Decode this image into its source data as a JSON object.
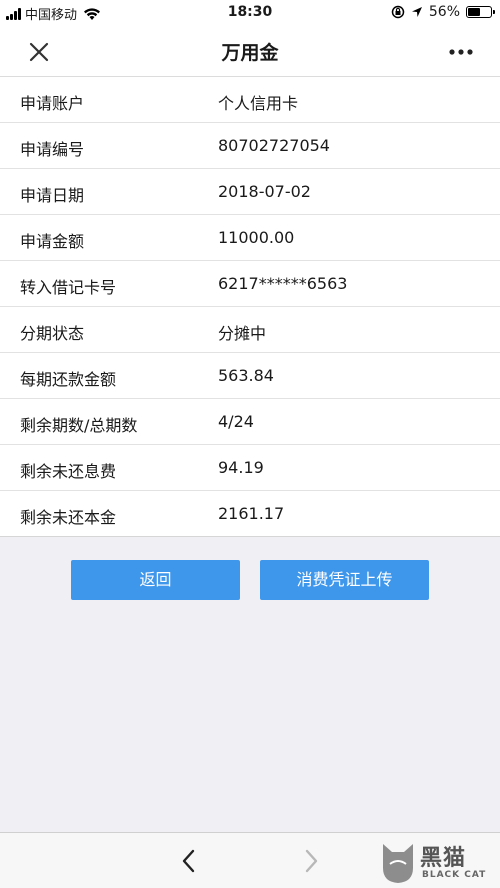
{
  "status_bar": {
    "carrier": "中国移动",
    "time": "18:30",
    "battery": "56%",
    "battery_level": 0.56
  },
  "nav": {
    "title": "万用金",
    "close_icon": "close-icon",
    "more_icon": "more-icon"
  },
  "details": [
    {
      "label": "申请账户",
      "value": "个人信用卡"
    },
    {
      "label": "申请编号",
      "value": "80702727054"
    },
    {
      "label": "申请日期",
      "value": "2018-07-02"
    },
    {
      "label": "申请金额",
      "value": "11000.00"
    },
    {
      "label": "转入借记卡号",
      "value": "6217******6563"
    },
    {
      "label": "分期状态",
      "value": "分摊中"
    },
    {
      "label": "每期还款金额",
      "value": "563.84"
    },
    {
      "label": "剩余期数/总期数",
      "value": "4/24"
    },
    {
      "label": "剩余未还息费",
      "value": "94.19"
    },
    {
      "label": "剩余未还本金",
      "value": "2161.17"
    }
  ],
  "buttons": {
    "back": "返回",
    "upload": "消费凭证上传"
  },
  "watermark": {
    "brand": "黑猫",
    "sub": "BLACK CAT"
  },
  "colors": {
    "accent": "#3f97ec",
    "background": "#efeff4"
  }
}
